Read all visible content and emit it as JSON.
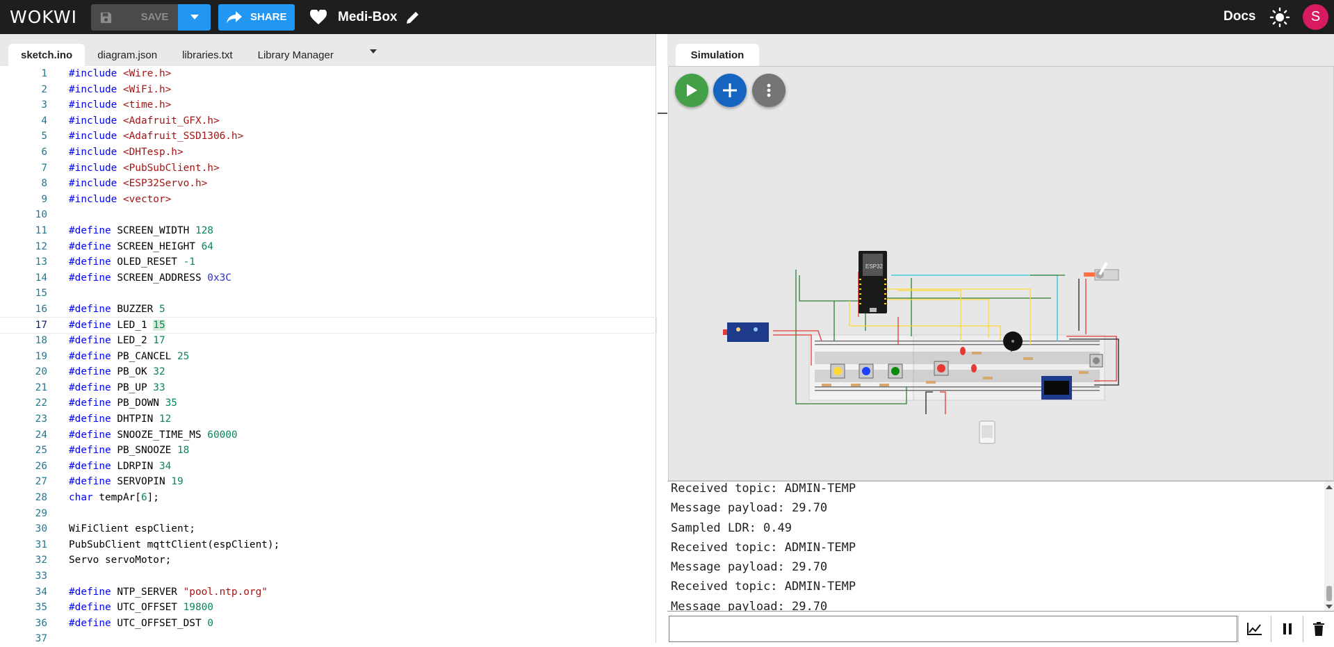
{
  "topbar": {
    "logo": "WOKWI",
    "save_label": "SAVE",
    "share_label": "SHARE",
    "project_name": "Medi-Box",
    "docs_label": "Docs",
    "avatar_letter": "S",
    "icons": [
      "floppy-icon",
      "chevron-down-icon",
      "share-arrow-icon",
      "heart-icon",
      "pencil-icon",
      "sun-icon"
    ]
  },
  "editor": {
    "tabs": [
      "sketch.ino",
      "diagram.json",
      "libraries.txt",
      "Library Manager"
    ],
    "active_tab": "sketch.ino",
    "current_line": 17,
    "lines": [
      {
        "n": "1",
        "t": "#include <Wire.h>"
      },
      {
        "n": "2",
        "t": "#include <WiFi.h>"
      },
      {
        "n": "3",
        "t": "#include <time.h>"
      },
      {
        "n": "4",
        "t": "#include <Adafruit_GFX.h>"
      },
      {
        "n": "5",
        "t": "#include <Adafruit_SSD1306.h>"
      },
      {
        "n": "6",
        "t": "#include <DHTesp.h>"
      },
      {
        "n": "7",
        "t": "#include <PubSubClient.h>"
      },
      {
        "n": "8",
        "t": "#include <ESP32Servo.h>"
      },
      {
        "n": "9",
        "t": "#include <vector>"
      },
      {
        "n": "10",
        "t": ""
      },
      {
        "n": "11",
        "t": "#define SCREEN_WIDTH 128"
      },
      {
        "n": "12",
        "t": "#define SCREEN_HEIGHT 64"
      },
      {
        "n": "13",
        "t": "#define OLED_RESET -1"
      },
      {
        "n": "14",
        "t": "#define SCREEN_ADDRESS 0x3C"
      },
      {
        "n": "15",
        "t": ""
      },
      {
        "n": "16",
        "t": "#define BUZZER 5"
      },
      {
        "n": "17",
        "t": "#define LED_1 15"
      },
      {
        "n": "18",
        "t": "#define LED_2 17"
      },
      {
        "n": "19",
        "t": "#define PB_CANCEL 25"
      },
      {
        "n": "20",
        "t": "#define PB_OK 32"
      },
      {
        "n": "21",
        "t": "#define PB_UP 33"
      },
      {
        "n": "22",
        "t": "#define PB_DOWN 35"
      },
      {
        "n": "23",
        "t": "#define DHTPIN 12"
      },
      {
        "n": "24",
        "t": "#define SNOOZE_TIME_MS 60000"
      },
      {
        "n": "25",
        "t": "#define PB_SNOOZE 18"
      },
      {
        "n": "26",
        "t": "#define LDRPIN 34"
      },
      {
        "n": "27",
        "t": "#define SERVOPIN 19"
      },
      {
        "n": "28",
        "t": "char tempAr[6];"
      },
      {
        "n": "29",
        "t": ""
      },
      {
        "n": "30",
        "t": "WiFiClient espClient;"
      },
      {
        "n": "31",
        "t": "PubSubClient mqttClient(espClient);"
      },
      {
        "n": "32",
        "t": "Servo servoMotor;"
      },
      {
        "n": "33",
        "t": ""
      },
      {
        "n": "34",
        "t": "#define NTP_SERVER \"pool.ntp.org\""
      },
      {
        "n": "35",
        "t": "#define UTC_OFFSET 19800"
      },
      {
        "n": "36",
        "t": "#define UTC_OFFSET_DST 0"
      },
      {
        "n": "37",
        "t": ""
      }
    ]
  },
  "simulation": {
    "tab_label": "Simulation",
    "buttons": [
      "play-icon",
      "plus-icon",
      "more-vertical-icon"
    ],
    "chip_label": "ESP32"
  },
  "serial": {
    "lines": [
      "Received topic: ADMIN-TEMP",
      "Message payload: 29.70",
      "Sampled LDR: 0.49",
      "Received topic: ADMIN-TEMP",
      "Message payload: 29.70",
      "Received topic: ADMIN-TEMP",
      "Message payload: 29.70"
    ],
    "input_value": "",
    "controls": [
      "chart-icon",
      "pause-icon",
      "trash-icon"
    ]
  },
  "colors": {
    "topbar": "#1e1e1e",
    "accent": "#2196f3",
    "play": "#43a047",
    "add": "#1565c0",
    "more": "#757575",
    "avatar": "#d81b60"
  }
}
